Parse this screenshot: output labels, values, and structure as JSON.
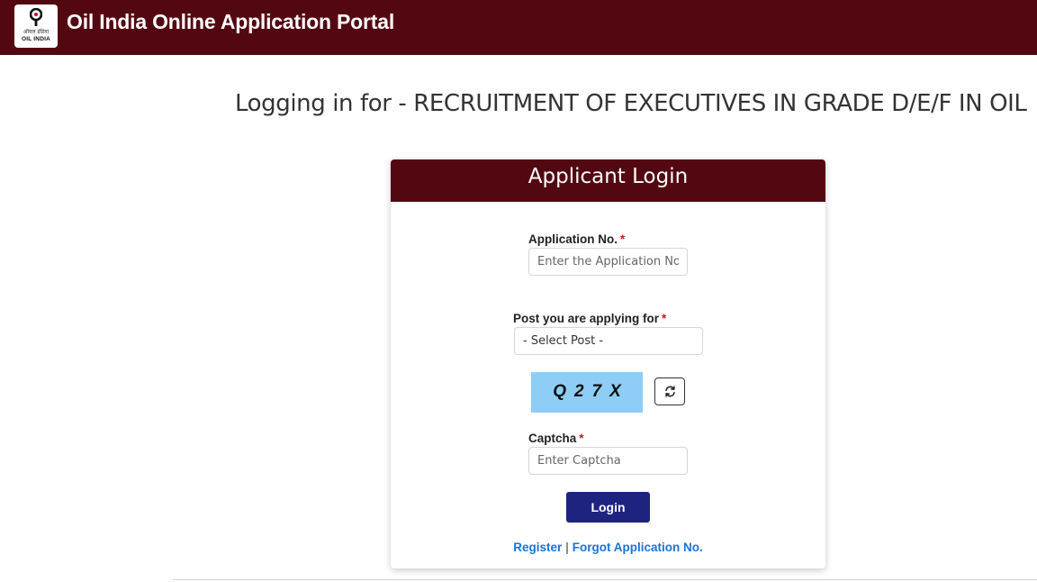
{
  "header": {
    "logo_hindi": "ऑयल इंडिया",
    "logo_text": "OIL INDIA",
    "title": "Oil India Online Application Portal"
  },
  "page": {
    "heading": "Logging in for - RECRUITMENT OF EXECUTIVES IN GRADE D/E/F IN OIL"
  },
  "login_card": {
    "title": "Applicant Login",
    "application_no": {
      "label": "Application No.",
      "required_mark": "*",
      "placeholder": "Enter the Application No.",
      "value": ""
    },
    "post": {
      "label": "Post you are applying for",
      "required_mark": "*",
      "selected": "- Select Post -"
    },
    "captcha_image_text": "Q27X",
    "captcha": {
      "label": "Captcha",
      "required_mark": "*",
      "placeholder": "Enter Captcha",
      "value": ""
    },
    "login_button": "Login",
    "register_link": "Register",
    "separator": "|",
    "forgot_link": "Forgot Application No."
  },
  "colors": {
    "brand_maroon": "#530811",
    "button_navy": "#1f2380",
    "link_blue": "#1a73d9",
    "captcha_bg": "#8ecdf6",
    "required_red": "#d9121f"
  },
  "icons": {
    "logo": "oil-drop-logo-icon",
    "refresh": "refresh-icon"
  }
}
